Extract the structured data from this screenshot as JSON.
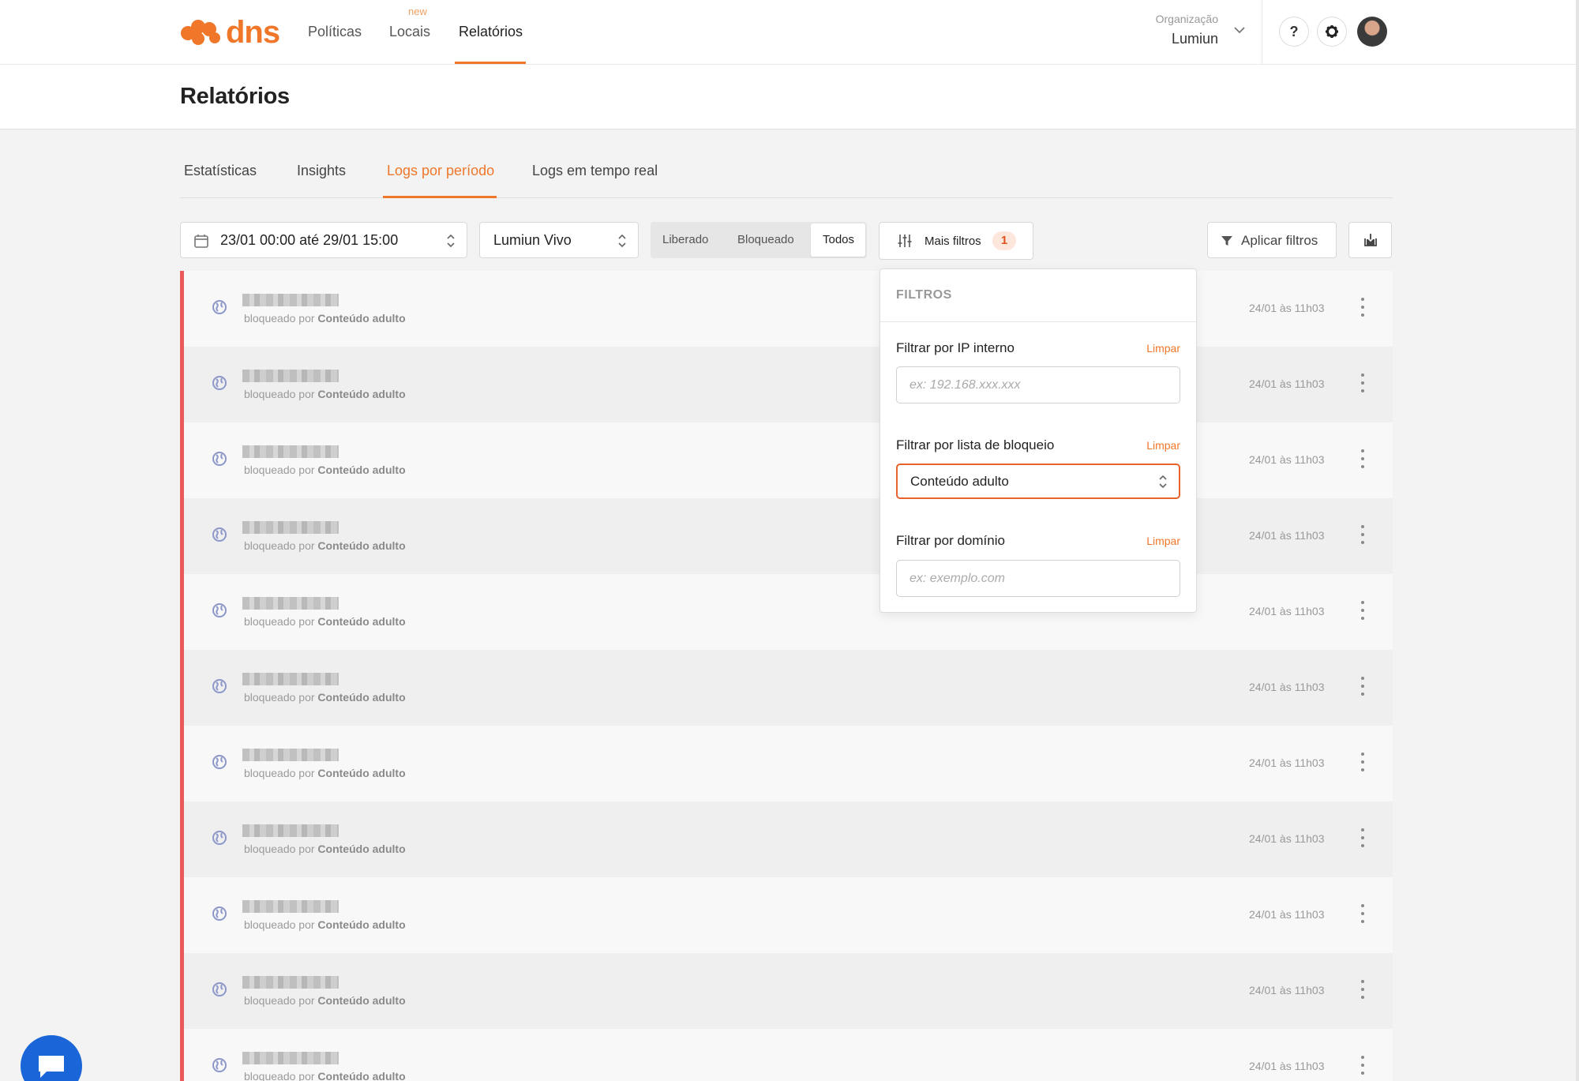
{
  "app": {
    "logo_text": "dns",
    "brand_color": "#f0772a"
  },
  "nav": {
    "items": [
      {
        "label": "Políticas",
        "active": false
      },
      {
        "label": "Locais",
        "active": false,
        "badge": "new"
      },
      {
        "label": "Relatórios",
        "active": true
      }
    ]
  },
  "org": {
    "label": "Organização",
    "name": "Lumiun"
  },
  "header_buttons": {
    "help": "?"
  },
  "page": {
    "title": "Relatórios"
  },
  "tabs": [
    {
      "label": "Estatísticas",
      "active": false
    },
    {
      "label": "Insights",
      "active": false
    },
    {
      "label": "Logs por período",
      "active": true
    },
    {
      "label": "Logs em tempo real",
      "active": false
    }
  ],
  "filters": {
    "date_range": "23/01 00:00 até 29/01 15:00",
    "location": "Lumiun Vivo",
    "status_options": [
      "Liberado",
      "Bloqueado",
      "Todos"
    ],
    "status_selected": "Todos",
    "more_filters_label": "Mais filtros",
    "more_filters_count": "1",
    "apply_label": "Aplicar filtros"
  },
  "popup": {
    "title": "FILTROS",
    "clear_label": "Limpar",
    "ip": {
      "label": "Filtrar por IP interno",
      "placeholder": "ex: 192.168.xxx.xxx"
    },
    "blocklist": {
      "label": "Filtrar por lista de bloqueio",
      "value": "Conteúdo adulto"
    },
    "domain": {
      "label": "Filtrar por domínio",
      "placeholder": "ex: exemplo.com"
    }
  },
  "logs": [
    {
      "reason_prefix": "bloqueado por",
      "reason": "Conteúdo adulto",
      "time": "24/01 às 11h03"
    },
    {
      "reason_prefix": "bloqueado por",
      "reason": "Conteúdo adulto",
      "time": "24/01 às 11h03"
    },
    {
      "reason_prefix": "bloqueado por",
      "reason": "Conteúdo adulto",
      "time": "24/01 às 11h03"
    },
    {
      "reason_prefix": "bloqueado por",
      "reason": "Conteúdo adulto",
      "time": "24/01 às 11h03"
    },
    {
      "reason_prefix": "bloqueado por",
      "reason": "Conteúdo adulto",
      "time": "24/01 às 11h03"
    },
    {
      "reason_prefix": "bloqueado por",
      "reason": "Conteúdo adulto",
      "time": "24/01 às 11h03"
    },
    {
      "reason_prefix": "bloqueado por",
      "reason": "Conteúdo adulto",
      "time": "24/01 às 11h03"
    },
    {
      "reason_prefix": "bloqueado por",
      "reason": "Conteúdo adulto",
      "time": "24/01 às 11h03"
    },
    {
      "reason_prefix": "bloqueado por",
      "reason": "Conteúdo adulto",
      "time": "24/01 às 11h03"
    },
    {
      "reason_prefix": "bloqueado por",
      "reason": "Conteúdo adulto",
      "time": "24/01 às 11h03"
    },
    {
      "reason_prefix": "bloqueado por",
      "reason": "Conteúdo adulto",
      "time": "24/01 às 11h03"
    }
  ],
  "icons": {
    "logo": "paw-cluster-icon",
    "row_icon": "globe-icon",
    "chat": "chat-bubble-icon"
  }
}
